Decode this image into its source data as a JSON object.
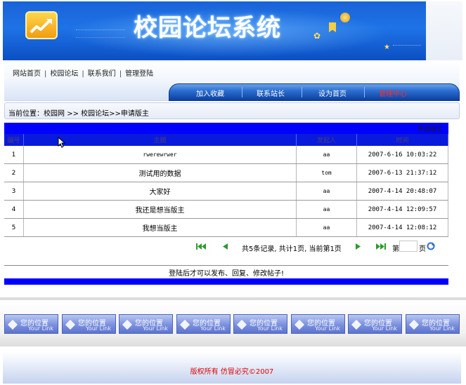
{
  "banner": {
    "title": "校园论坛系统"
  },
  "topnav": {
    "links": [
      "网站首页",
      "校园论坛",
      "联系我们",
      "管理登陆"
    ],
    "separator": "|"
  },
  "menubar": {
    "items": [
      "加入收藏",
      "联系站长",
      "设为首页",
      "管理中心"
    ],
    "admin_color": "#ff2a2a"
  },
  "breadcrumb": {
    "label": "当前位置：",
    "home": "校园网",
    "sep": ">>",
    "section": "校园论坛",
    "page": "申请版主"
  },
  "table": {
    "apply_button": "申请版主",
    "headers": [
      "编号",
      "主题",
      "发起人",
      "时间"
    ],
    "rows": [
      {
        "id": "1",
        "subject": "rwerewrwer",
        "author": "aa",
        "time": "2007-6-16 10:03:22"
      },
      {
        "id": "2",
        "subject": "测试用的数据",
        "author": "tom",
        "time": "2007-6-13 21:37:12"
      },
      {
        "id": "3",
        "subject": "大家好",
        "author": "aa",
        "time": "2007-4-14 20:48:07"
      },
      {
        "id": "4",
        "subject": "我还是想当版主",
        "author": "aa",
        "time": "2007-4-14 12:09:57"
      },
      {
        "id": "5",
        "subject": "我想当版主",
        "author": "aa",
        "time": "2007-4-14 12:08:12"
      }
    ],
    "header_color": "#0a1adc",
    "bar_color": "#0000ff"
  },
  "pager": {
    "summary": "共5条记录, 共计1页, 当前第1页",
    "page_label": "第",
    "page_unit": "页",
    "page_value": "",
    "icons": [
      "first-page-icon",
      "prev-page-icon",
      "next-page-icon",
      "last-page-icon",
      "go-icon"
    ]
  },
  "notice": "登陆后才可以发布、回复、修改帖子!",
  "tiles": [
    {
      "title": "您的位置",
      "sub": "Your Link"
    },
    {
      "title": "您的位置",
      "sub": "Your Link"
    },
    {
      "title": "您的位置",
      "sub": "Your Link"
    },
    {
      "title": "您的位置",
      "sub": "Your Link"
    },
    {
      "title": "您的位置",
      "sub": "Your Link"
    },
    {
      "title": "您的位置",
      "sub": "Your Link"
    },
    {
      "title": "您的位置",
      "sub": "Your Link"
    },
    {
      "title": "您的位置",
      "sub": "Your Link"
    }
  ],
  "footer": {
    "copyright": "版权所有  仿冒必究©2007"
  }
}
